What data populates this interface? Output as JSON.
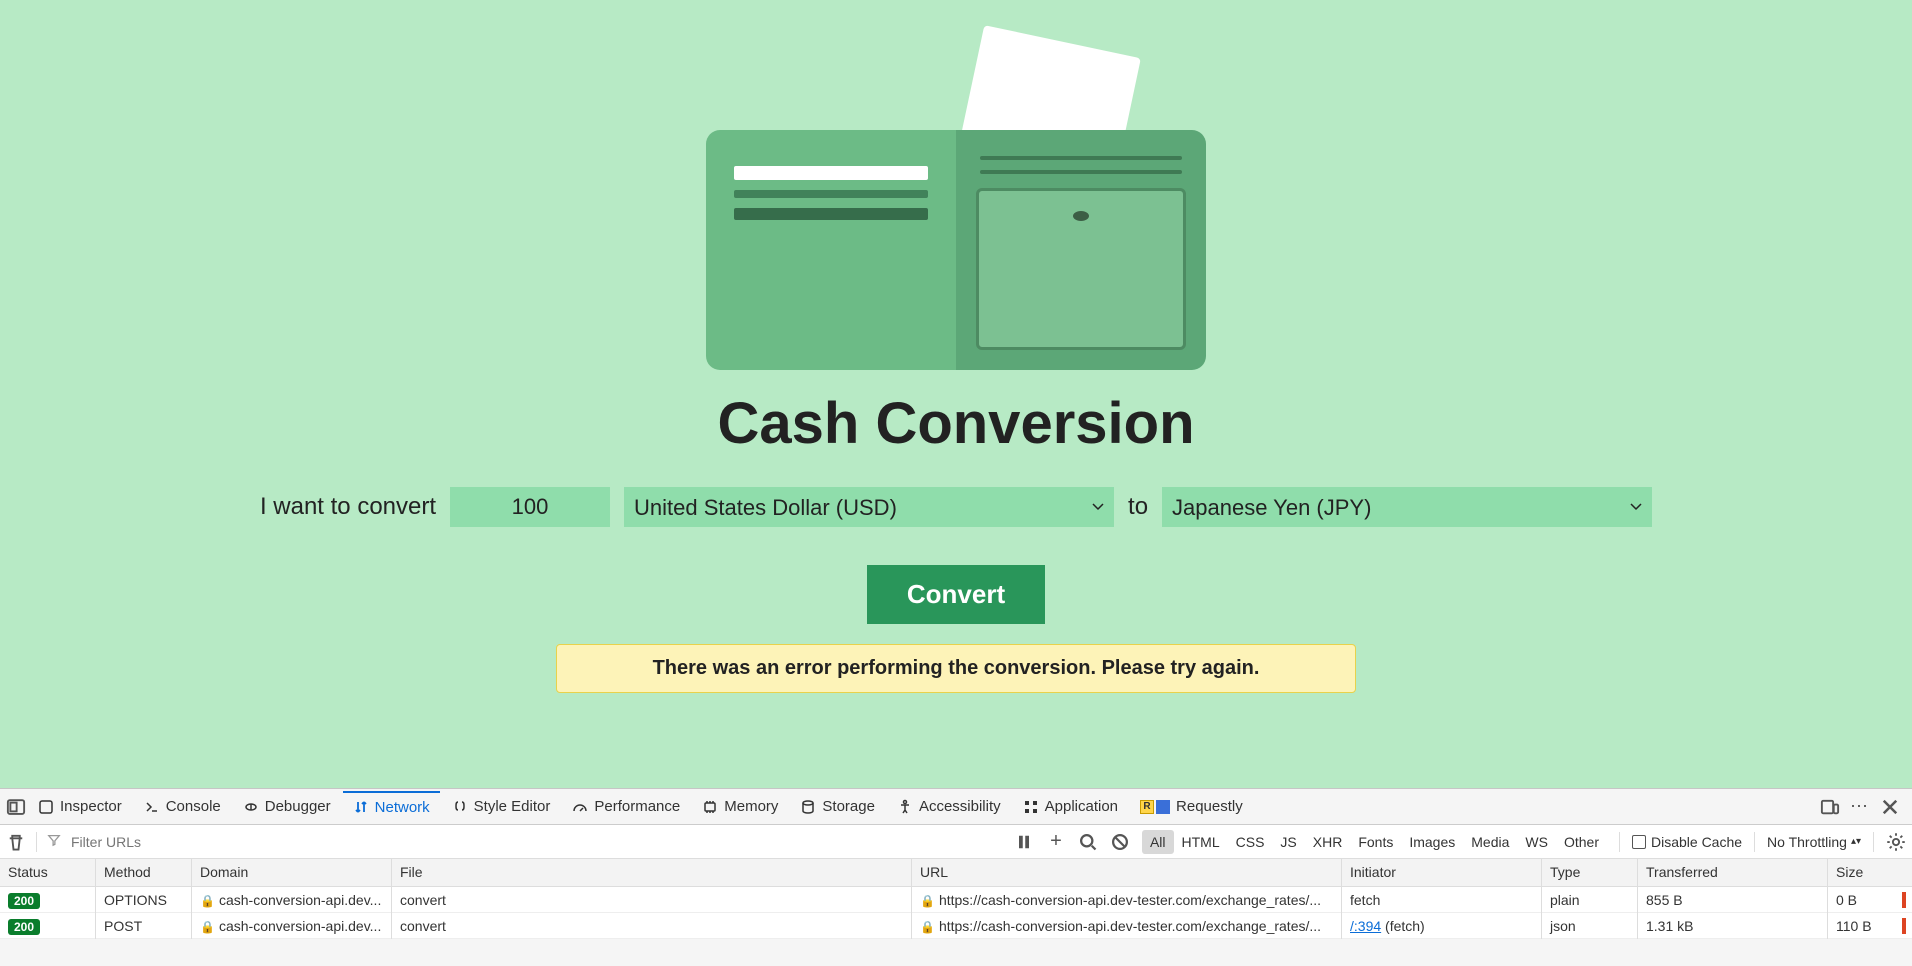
{
  "app": {
    "title": "Cash Conversion",
    "label_prefix": "I want to convert",
    "amount": "100",
    "from_currency": "United States Dollar (USD)",
    "to_label": "to",
    "to_currency": "Japanese Yen (JPY)",
    "button": "Convert",
    "error": "There was an error performing the conversion. Please try again."
  },
  "devtools": {
    "tabs": {
      "inspector": "Inspector",
      "console": "Console",
      "debugger": "Debugger",
      "network": "Network",
      "style": "Style Editor",
      "performance": "Performance",
      "memory": "Memory",
      "storage": "Storage",
      "accessibility": "Accessibility",
      "application": "Application",
      "requestly": "Requestly"
    },
    "filter_placeholder": "Filter URLs",
    "type_filters": [
      "All",
      "HTML",
      "CSS",
      "JS",
      "XHR",
      "Fonts",
      "Images",
      "Media",
      "WS",
      "Other"
    ],
    "disable_cache": "Disable Cache",
    "throttle": "No Throttling",
    "columns": {
      "status": "Status",
      "method": "Method",
      "domain": "Domain",
      "file": "File",
      "url": "URL",
      "initiator": "Initiator",
      "type": "Type",
      "transferred": "Transferred",
      "size": "Size"
    },
    "rows": [
      {
        "status": "200",
        "method": "OPTIONS",
        "domain": "cash-conversion-api.dev...",
        "file": "convert",
        "url": "https://cash-conversion-api.dev-tester.com/exchange_rates/...",
        "initiator": "fetch",
        "init_link": "",
        "type": "plain",
        "transferred": "855 B",
        "size": "0 B"
      },
      {
        "status": "200",
        "method": "POST",
        "domain": "cash-conversion-api.dev...",
        "file": "convert",
        "url": "https://cash-conversion-api.dev-tester.com/exchange_rates/...",
        "initiator": "(fetch)",
        "init_link": "/:394",
        "type": "json",
        "transferred": "1.31 kB",
        "size": "110 B"
      }
    ]
  }
}
